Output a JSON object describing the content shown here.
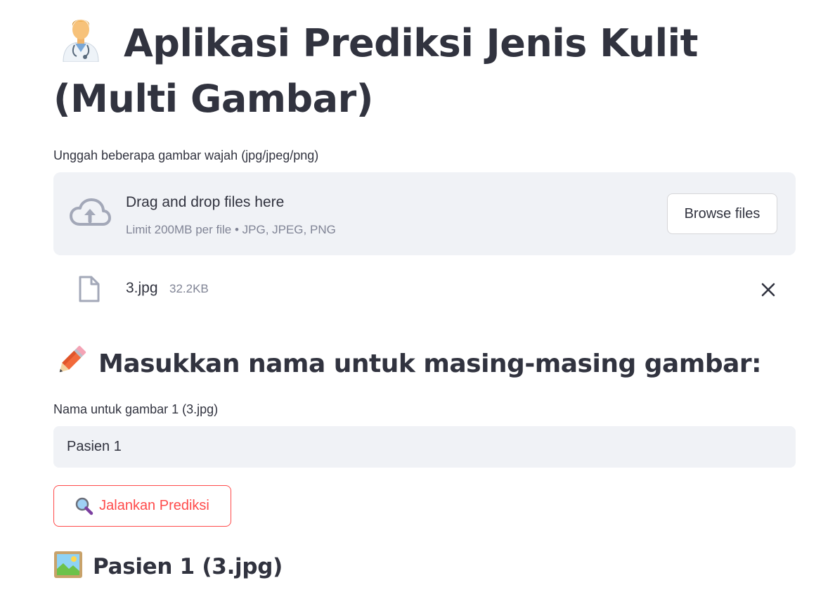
{
  "header": {
    "title": "Aplikasi Prediksi Jenis Kulit (Multi Gambar)",
    "title_icon": "health-worker-emoji"
  },
  "uploader": {
    "label": "Unggah beberapa gambar wajah (jpg/jpeg/png)",
    "drop_text": "Drag and drop files here",
    "limit_text": "Limit 200MB per file • JPG, JPEG, PNG",
    "browse_label": "Browse files",
    "icon": "cloud-upload-icon"
  },
  "files": [
    {
      "name": "3.jpg",
      "size": "32.2KB",
      "icon": "file-icon"
    }
  ],
  "names_section": {
    "heading": "Masukkan nama untuk masing-masing gambar:",
    "heading_icon": "pencil-emoji",
    "inputs": [
      {
        "label": "Nama untuk gambar 1 (3.jpg)",
        "value": "Pasien 1"
      }
    ]
  },
  "predict_button": {
    "label": "Jalankan Prediksi",
    "icon": "magnifier-emoji"
  },
  "results": [
    {
      "heading": "Pasien 1 (3.jpg)",
      "icon": "framed-picture-emoji"
    }
  ],
  "colors": {
    "text": "#31333f",
    "muted": "#808495",
    "surface": "#f0f2f6",
    "accent": "#ff4b4b"
  }
}
